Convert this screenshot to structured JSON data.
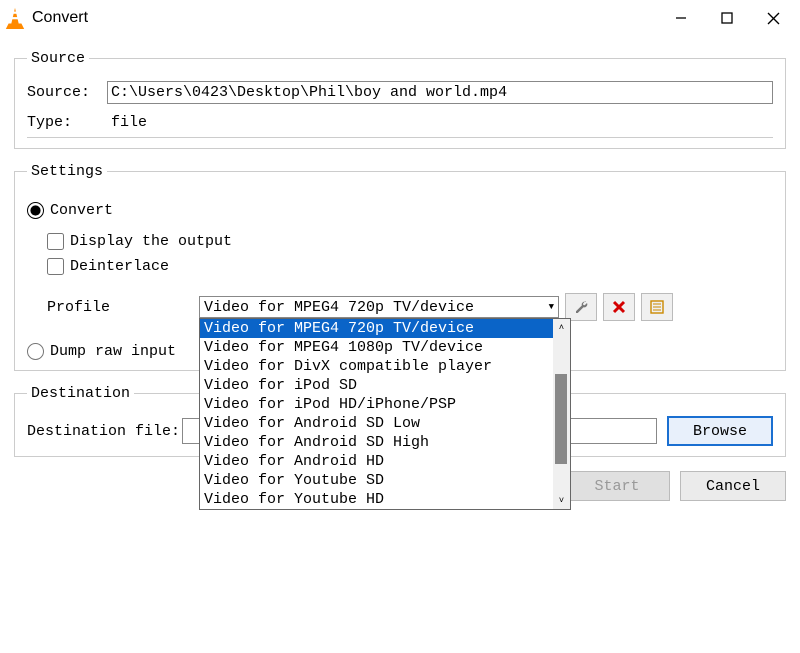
{
  "window": {
    "title": "Convert"
  },
  "source": {
    "legend": "Source",
    "label": "Source:",
    "value": "C:\\Users\\0423\\Desktop\\Phil\\boy and world.mp4",
    "type_label": "Type:",
    "type_value": "file"
  },
  "settings": {
    "legend": "Settings",
    "convert_label": "Convert",
    "display_output_label": "Display the output",
    "deinterlace_label": "Deinterlace",
    "profile_label": "Profile",
    "profile_selected": "Video for MPEG4 720p TV/device",
    "profile_options": [
      "Video for MPEG4 720p TV/device",
      "Video for MPEG4 1080p TV/device",
      "Video for DivX compatible player",
      "Video for iPod SD",
      "Video for iPod HD/iPhone/PSP",
      "Video for Android SD Low",
      "Video for Android SD High",
      "Video for Android HD",
      "Video for Youtube SD",
      "Video for Youtube HD"
    ],
    "dump_raw_label": "Dump raw input"
  },
  "destination": {
    "legend": "Destination",
    "label": "Destination file:",
    "browse_label": "Browse"
  },
  "buttons": {
    "start": "Start",
    "cancel": "Cancel"
  },
  "icons": {
    "wrench": "wrench-icon",
    "delete": "delete-icon",
    "new": "new-profile-icon"
  }
}
